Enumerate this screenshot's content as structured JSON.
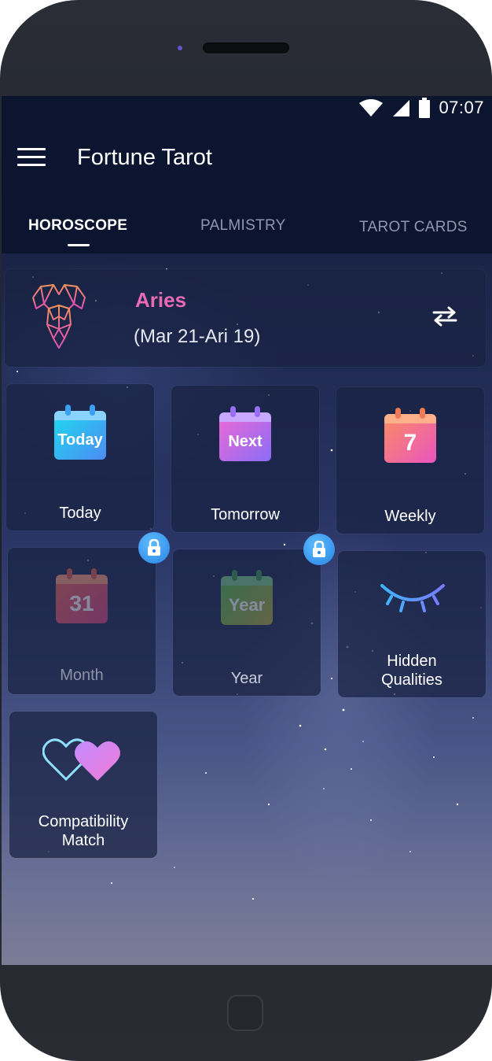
{
  "status_bar": {
    "time": "07:07",
    "icons": [
      "wifi-icon",
      "signal-icon",
      "battery-icon"
    ]
  },
  "app_bar": {
    "title": "Fortune Tarot",
    "menu_icon": "hamburger-menu-icon"
  },
  "tabs": [
    {
      "label": "HOROSCOPE",
      "active": true
    },
    {
      "label": "PALMISTRY",
      "active": false
    },
    {
      "label": "TAROT CARDS",
      "active": false
    }
  ],
  "sign": {
    "name": "Aries",
    "dates": "(Mar 21-Ari 19)",
    "icon": "aries-ram-icon",
    "switch_icon": "swap-arrows-icon"
  },
  "tiles": [
    {
      "label": "Today",
      "icon": "calendar-today-icon",
      "badge": "Today",
      "locked": false
    },
    {
      "label": "Tomorrow",
      "icon": "calendar-next-icon",
      "badge": "Next",
      "locked": false
    },
    {
      "label": "Weekly",
      "icon": "calendar-week-icon",
      "badge": "7",
      "locked": false
    },
    {
      "label": "Month",
      "icon": "calendar-month-icon",
      "badge": "31",
      "locked": true
    },
    {
      "label": "Year",
      "icon": "calendar-year-icon",
      "badge": "Year",
      "locked": true
    },
    {
      "label_line1": "Hidden",
      "label_line2": "Qualities",
      "icon": "closed-eye-icon",
      "locked": false
    },
    {
      "label_line1": "Compatibility",
      "label_line2": "Match",
      "icon": "hearts-icon",
      "locked": false
    }
  ],
  "colors": {
    "accent_pink": "#e66bb3",
    "lock_blue": "#2784e6",
    "app_bar_bg": "#0b1530"
  }
}
